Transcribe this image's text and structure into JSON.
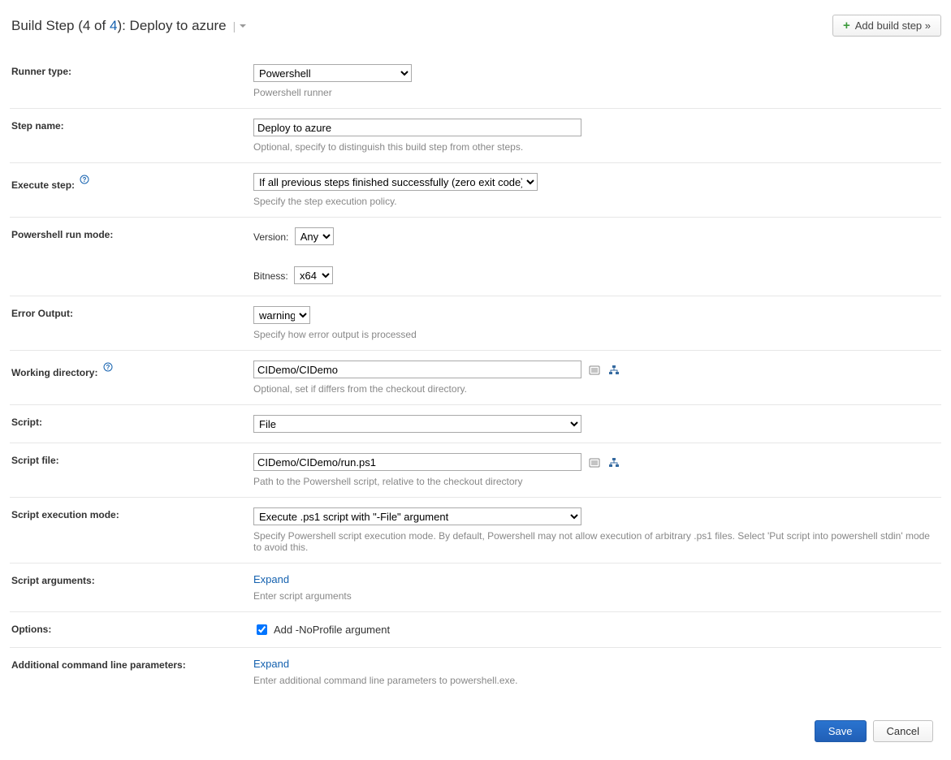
{
  "header": {
    "title_prefix": "Build Step (4 of ",
    "title_link": "4",
    "title_suffix": "): Deploy to azure",
    "add_button": "Add build step »"
  },
  "runner": {
    "label": "Runner type:",
    "value": "Powershell",
    "hint": "Powershell runner"
  },
  "step_name": {
    "label": "Step name:",
    "value": "Deploy to azure",
    "hint": "Optional, specify to distinguish this build step from other steps."
  },
  "execute_step": {
    "label": "Execute step:",
    "value": "If all previous steps finished successfully (zero exit code)",
    "hint": "Specify the step execution policy."
  },
  "runmode": {
    "label": "Powershell run mode:",
    "version_label": "Version:",
    "version_value": "Any",
    "bitness_label": "Bitness:",
    "bitness_value": "x64"
  },
  "error_output": {
    "label": "Error Output:",
    "value": "warning",
    "hint": "Specify how error output is processed"
  },
  "working_dir": {
    "label": "Working directory:",
    "value": "CIDemo/CIDemo",
    "hint": "Optional, set if differs from the checkout directory."
  },
  "script": {
    "label": "Script:",
    "value": "File"
  },
  "script_file": {
    "label": "Script file:",
    "value": "CIDemo/CIDemo/run.ps1",
    "hint": "Path to the Powershell script, relative to the checkout directory"
  },
  "script_exec_mode": {
    "label": "Script execution mode:",
    "value": "Execute .ps1 script with \"-File\" argument",
    "hint": "Specify Powershell script execution mode. By default, Powershell may not allow execution of arbitrary .ps1 files. Select 'Put script into powershell stdin' mode to avoid this."
  },
  "script_args": {
    "label": "Script arguments:",
    "expand": "Expand",
    "hint": "Enter script arguments"
  },
  "options": {
    "label": "Options:",
    "checkbox_label": "Add -NoProfile argument",
    "checked": true
  },
  "additional_params": {
    "label": "Additional command line parameters:",
    "expand": "Expand",
    "hint": "Enter additional command line parameters to powershell.exe."
  },
  "buttons": {
    "save": "Save",
    "cancel": "Cancel"
  }
}
